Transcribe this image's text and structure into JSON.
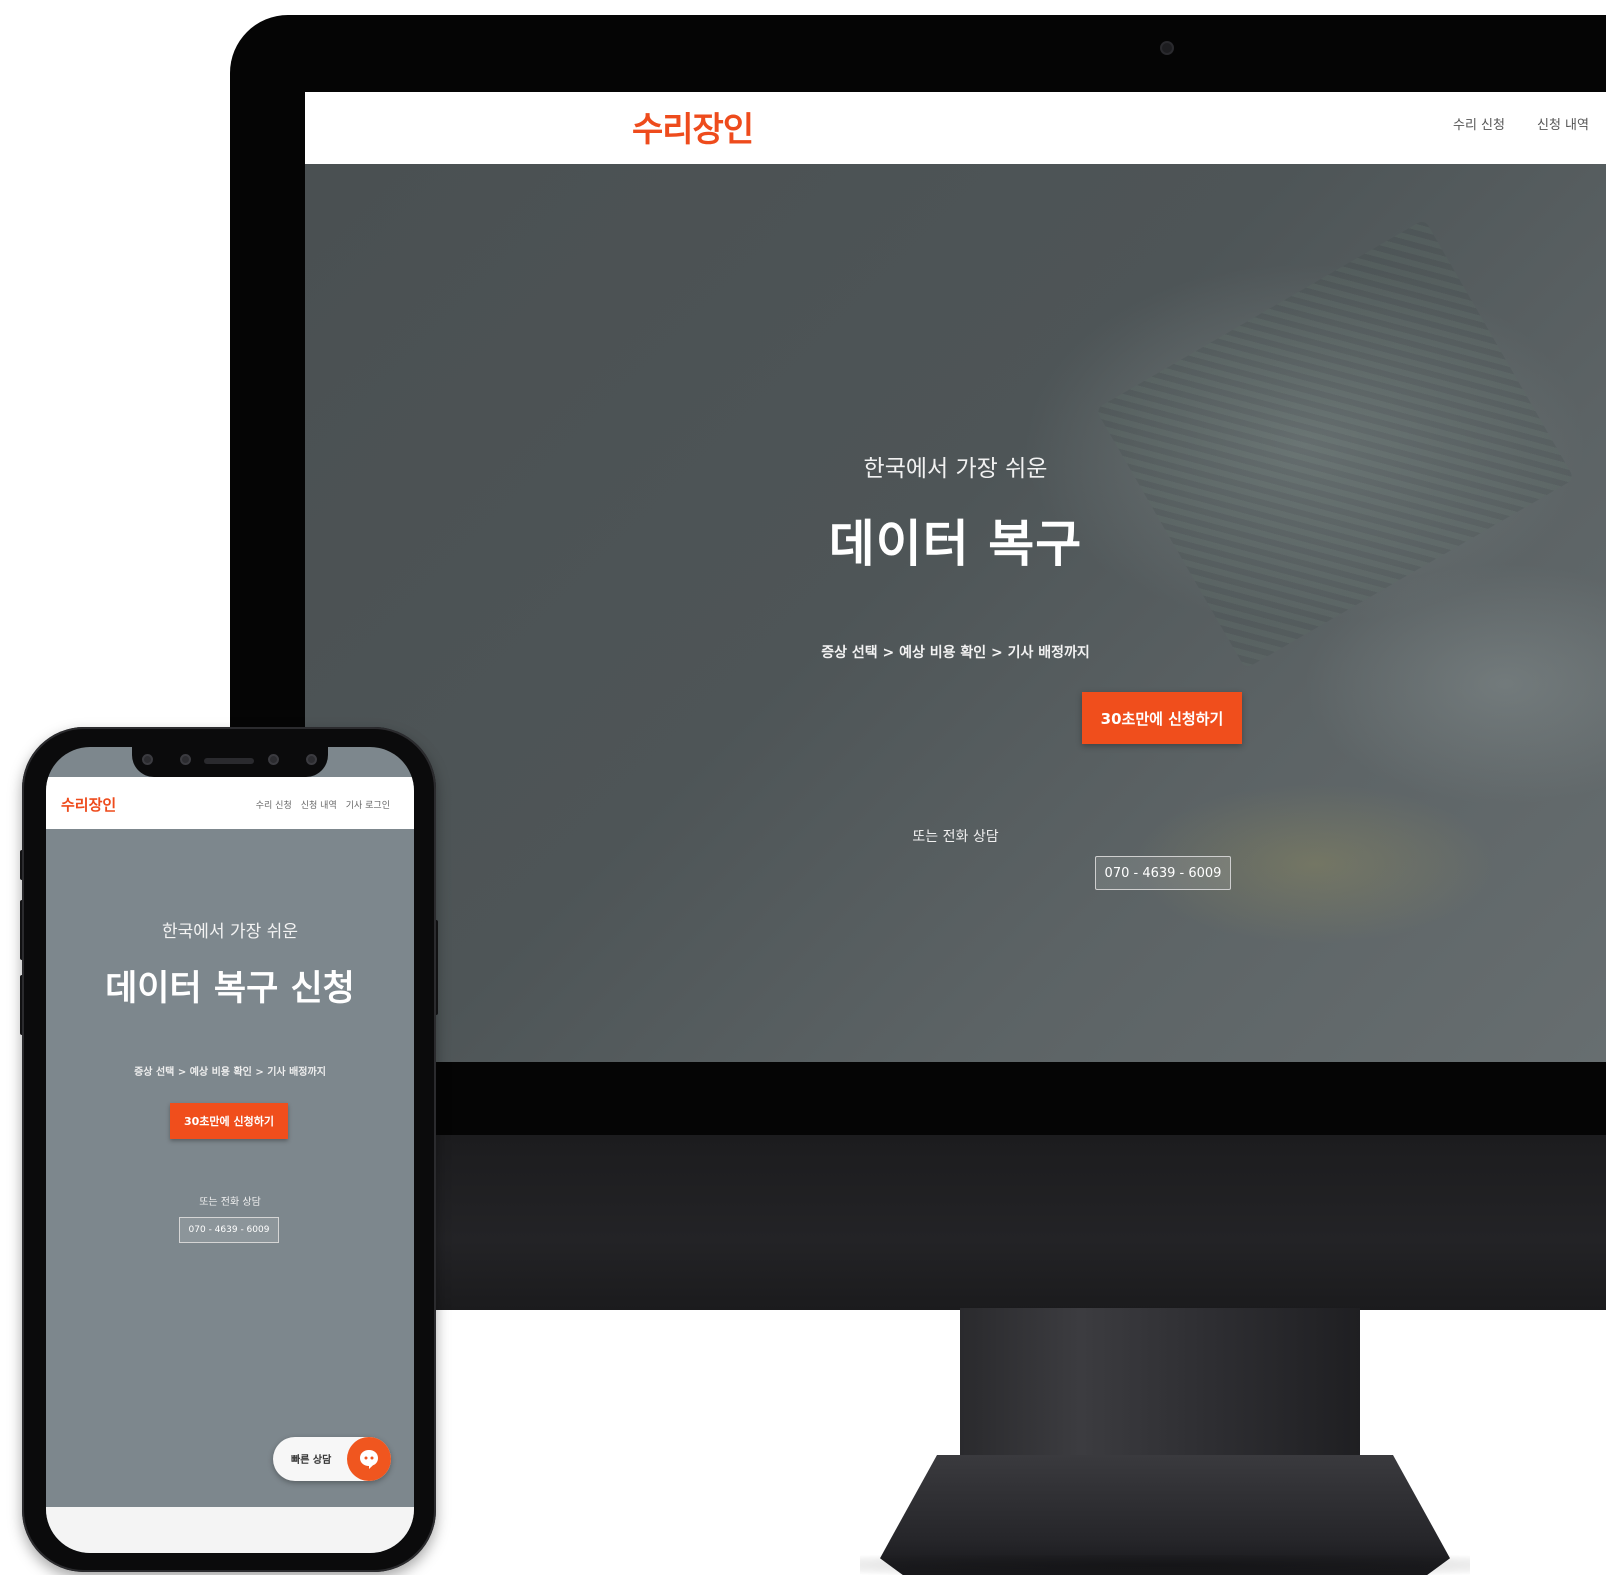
{
  "desktop": {
    "logo": "수리장인",
    "nav": [
      "수리 신청",
      "신청 내역"
    ],
    "hero": {
      "subtitle": "한국에서 가장 쉬운",
      "title": "데이터 복구",
      "steps": "증상 선택 > 예상 비용 확인 > 기사 배정까지",
      "cta_label": "30초만에 신청하기",
      "or_label": "또는 전화 상담",
      "phone_number": "070 - 4639 - 6009"
    }
  },
  "mobile": {
    "logo": "수리장인",
    "nav": [
      "수리 신청",
      "신청 내역",
      "기사 로그인"
    ],
    "hero": {
      "subtitle": "한국에서 가장 쉬운",
      "title": "데이터 복구 신청",
      "steps": "증상 선택 > 예상 비용 확인 > 기사 배정까지",
      "cta_label": "30초만에 신청하기",
      "or_label": "또는 전화 상담",
      "phone_number": "070 - 4639 - 6009"
    },
    "chat_button": {
      "label": "빠른 상담",
      "icon": "chat-bubble-icon"
    }
  },
  "colors": {
    "brand_orange": "#f04e1c",
    "hero_overlay_desktop": "#4b5254",
    "hero_overlay_mobile": "#7d878d",
    "device_black": "#0b0b0c"
  }
}
